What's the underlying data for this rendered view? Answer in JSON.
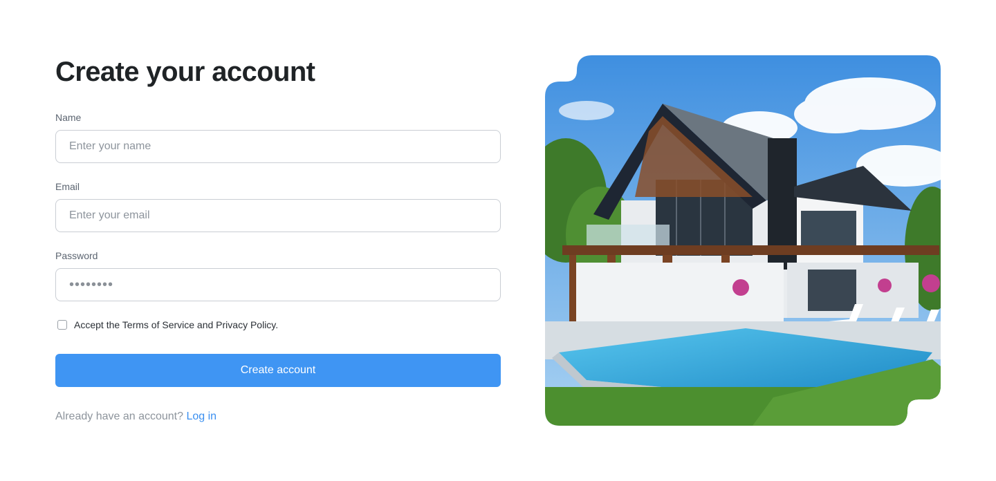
{
  "signup": {
    "title": "Create your account",
    "name_label": "Name",
    "name_placeholder": "Enter your name",
    "email_label": "Email",
    "email_placeholder": "Enter your email",
    "password_label": "Password",
    "password_value": "••••••••",
    "terms_text": "Accept the Terms of Service and Privacy Policy.",
    "terms_checked": false,
    "submit_label": "Create account",
    "login_prompt": "Already have an account?",
    "login_link": "Log in"
  },
  "hero": {
    "image_subject": "modern-house-with-pool",
    "colors": {
      "sky": "#5aa6e8",
      "roof": "#1e2633",
      "wood": "#8a4f2a",
      "pool": "#2fb3e6",
      "grass": "#4c8f2f"
    }
  },
  "theme": {
    "accent": "#3f95f3",
    "link": "#3a8ff0"
  }
}
